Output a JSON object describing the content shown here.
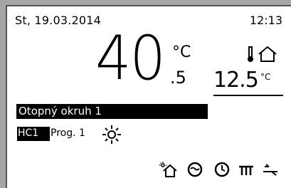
{
  "header": {
    "date": "St, 19.03.2014",
    "time": "12:13"
  },
  "room": {
    "temp_whole": "40",
    "temp_unit": "°C",
    "temp_decimal": ".5"
  },
  "outdoor": {
    "icon": "thermometer-house-icon",
    "temp": "12.5",
    "unit": "°C"
  },
  "circuit": {
    "name": "Otopný okruh 1"
  },
  "program": {
    "hc": "HC1",
    "label": "Prog. 1",
    "mode_icon": "sun-icon"
  },
  "bottom_icons": [
    "solar-house-icon",
    "hot-water-icon",
    "clock-icon",
    "radiator-icon",
    "ventilation-icon"
  ]
}
